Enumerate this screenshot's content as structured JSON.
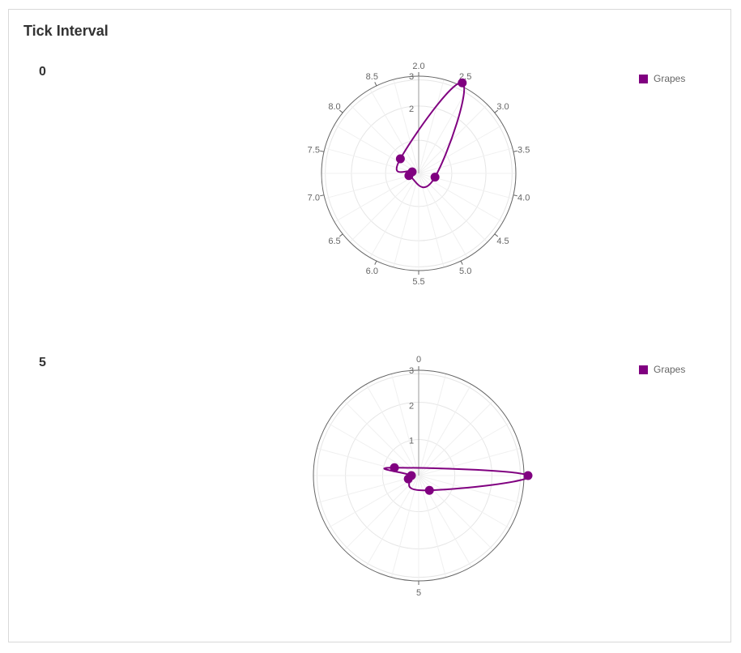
{
  "panel": {
    "title": "Tick Interval"
  },
  "colors": {
    "series": "#800080",
    "grid": "#e6e6e6",
    "axis": "#666666",
    "label": "#666666"
  },
  "chart_data": [
    {
      "type": "polar-line",
      "label": "0",
      "series": [
        {
          "name": "Grapes",
          "color": "#800080",
          "points": [
            {
              "x": 2.5,
              "y": 3.0
            },
            {
              "x": 4.0,
              "y": 0.5
            },
            {
              "x": 7.0,
              "y": 0.3
            },
            {
              "x": 7.5,
              "y": 0.2
            },
            {
              "x": 8.0,
              "y": 0.7
            }
          ]
        }
      ],
      "x_ticks": [
        "2.0",
        "2.5",
        "3.0",
        "3.5",
        "4.0",
        "4.5",
        "5.0",
        "5.5",
        "6.0",
        "6.5",
        "7.0",
        "7.5",
        "8.0",
        "8.5"
      ],
      "x_range": [
        2,
        9
      ],
      "radial_ticks": [
        "2",
        "3"
      ],
      "radial_range": [
        0,
        3
      ],
      "legend": "top-right"
    },
    {
      "type": "polar-line",
      "label": "5",
      "series": [
        {
          "name": "Grapes",
          "color": "#800080",
          "points": [
            {
              "x": 2.5,
              "y": 3.0
            },
            {
              "x": 4.0,
              "y": 0.5
            },
            {
              "x": 7.0,
              "y": 0.3
            },
            {
              "x": 7.5,
              "y": 0.2
            },
            {
              "x": 8.0,
              "y": 0.7
            }
          ]
        }
      ],
      "x_ticks": [
        "0",
        "5"
      ],
      "x_range": [
        0,
        10
      ],
      "radial_ticks": [
        "1",
        "2",
        "3"
      ],
      "radial_range": [
        0,
        3
      ],
      "legend": "top-right"
    }
  ]
}
